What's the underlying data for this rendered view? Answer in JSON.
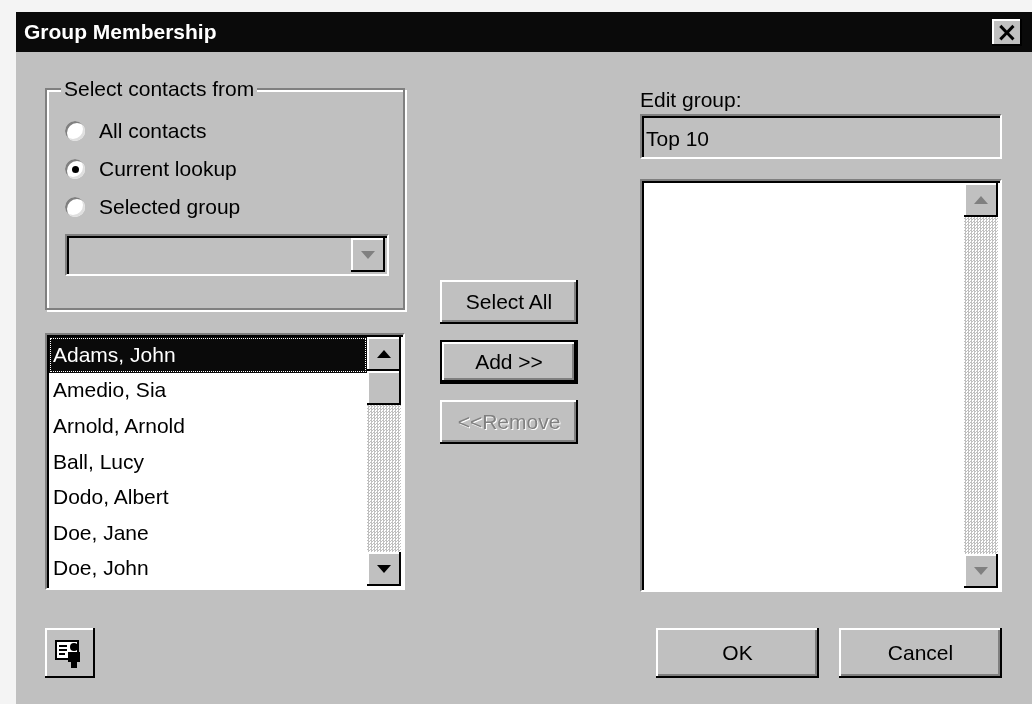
{
  "window": {
    "title": "Group Membership",
    "close_label": "×"
  },
  "source_group": {
    "label": "Select contacts from",
    "options": [
      {
        "label": "All contacts",
        "selected": false
      },
      {
        "label": "Current lookup",
        "selected": true
      },
      {
        "label": "Selected group",
        "selected": false
      }
    ],
    "group_dropdown": {
      "disabled": true
    }
  },
  "contacts": [
    {
      "name": "Adams, John",
      "selected": true
    },
    {
      "name": "Amedio, Sia",
      "selected": false
    },
    {
      "name": "Arnold, Arnold",
      "selected": false
    },
    {
      "name": "Ball, Lucy",
      "selected": false
    },
    {
      "name": "Dodo, Albert",
      "selected": false
    },
    {
      "name": "Doe, Jane",
      "selected": false
    },
    {
      "name": "Doe, John",
      "selected": false
    }
  ],
  "buttons": [
    {
      "label": "Select All",
      "disabled": false,
      "default": false
    },
    {
      "label": "Add >>",
      "disabled": false,
      "default": true
    },
    {
      "label": "<<Remove",
      "disabled": true,
      "default": false
    }
  ],
  "edit_group": {
    "label": "Edit group:",
    "value": "Top 10"
  },
  "footer_buttons": [
    {
      "label": "OK"
    },
    {
      "label": "Cancel"
    }
  ]
}
